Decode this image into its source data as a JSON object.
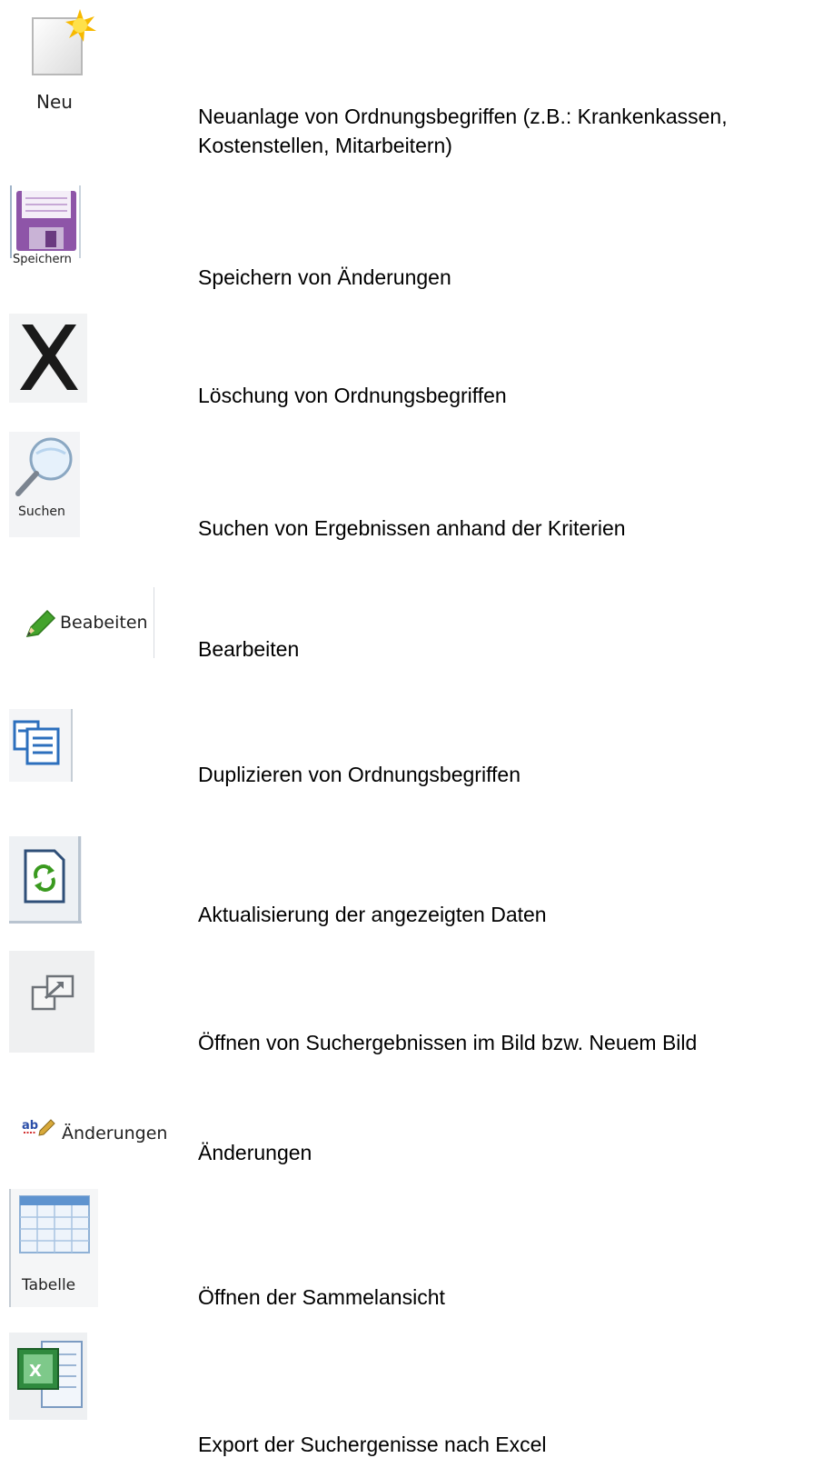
{
  "items": [
    {
      "icon": "new-document-icon",
      "icon_label": "Neu",
      "desc": "Neuanlage von Ordnungsbegriffen (z.B.: Krankenkassen, Kostenstellen, Mitarbeitern)"
    },
    {
      "icon": "floppy-disk-icon",
      "icon_label": "Speichern",
      "desc": "Speichern von Änderungen"
    },
    {
      "icon": "delete-x-icon",
      "icon_label": "",
      "desc": "Löschung von Ordnungsbegriffen"
    },
    {
      "icon": "magnifier-icon",
      "icon_label": "Suchen",
      "desc": "Suchen von Ergebnissen anhand der Kriterien"
    },
    {
      "icon": "pencil-icon",
      "icon_label": "Beabeiten",
      "desc": "Bearbeiten"
    },
    {
      "icon": "duplicate-icon",
      "icon_label": "",
      "desc": "Duplizieren von Ordnungsbegriffen"
    },
    {
      "icon": "refresh-document-icon",
      "icon_label": "",
      "desc": "Aktualisierung der angezeigten Daten"
    },
    {
      "icon": "open-window-icon",
      "icon_label": "",
      "desc": "Öffnen von Suchergebnissen im Bild bzw. Neuem Bild"
    },
    {
      "icon": "spellcheck-ab-icon",
      "icon_label": "Änderungen",
      "desc": "Änderungen"
    },
    {
      "icon": "table-icon",
      "icon_label": "Tabelle",
      "desc": "Öffnen der Sammelansicht"
    },
    {
      "icon": "excel-export-icon",
      "icon_label": "",
      "desc": "Export der Suchergenisse nach Excel"
    }
  ]
}
